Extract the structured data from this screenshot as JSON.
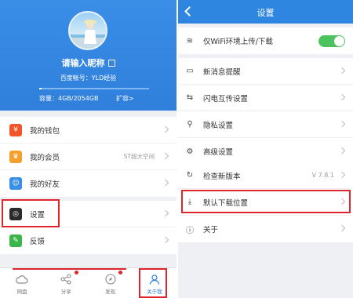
{
  "left": {
    "profile": {
      "nickname": "请输入昵称",
      "account": "百度帐号：YLD经验",
      "storage_text": "容量：4GB/2054GB",
      "storage_fraction": 0.0019,
      "expand_label": "扩容>"
    },
    "menu_group1": [
      {
        "label": "我的钱包",
        "icon": "wallet-icon",
        "color": "#f2552c",
        "glyph": "¥"
      },
      {
        "label": "我的会员",
        "icon": "crown-icon",
        "color": "#f4a02a",
        "glyph": "♛",
        "extra": "ST超大空间"
      },
      {
        "label": "我的好友",
        "icon": "friend-icon",
        "color": "#3a8ee6",
        "glyph": "☺"
      }
    ],
    "menu_group2": [
      {
        "label": "设置",
        "icon": "settings-icon",
        "color": "#2b2b2b",
        "glyph": "◎"
      },
      {
        "label": "反馈",
        "icon": "feedback-icon",
        "color": "#3bb54a",
        "glyph": "✎"
      }
    ],
    "tabs": [
      {
        "label": "网盘",
        "icon": "cloud-icon"
      },
      {
        "label": "分享",
        "icon": "share-icon",
        "badge": true
      },
      {
        "label": "发现",
        "icon": "compass-icon",
        "badge": true
      },
      {
        "label": "关于我",
        "icon": "person-icon",
        "active": true
      }
    ]
  },
  "right": {
    "title": "设置",
    "group1": [
      {
        "label": "仅WiFi环境上传/下载",
        "icon": "wifi-icon",
        "glyph": "≋",
        "toggle": true
      }
    ],
    "group2": [
      {
        "label": "新消息提醒",
        "icon": "message-icon",
        "glyph": "▭"
      },
      {
        "label": "闪电互传设置",
        "icon": "transfer-icon",
        "glyph": "⇆"
      },
      {
        "label": "隐私设置",
        "icon": "privacy-icon",
        "glyph": "⚲"
      },
      {
        "label": "高级设置",
        "icon": "gear-icon",
        "glyph": "⚙"
      }
    ],
    "group3": [
      {
        "label": "检查新版本",
        "icon": "refresh-icon",
        "glyph": "↻",
        "version": "V 7.8.1"
      },
      {
        "label": "默认下载位置",
        "icon": "download-icon",
        "glyph": "⤓"
      },
      {
        "label": "关于",
        "icon": "info-icon",
        "glyph": "ⓘ"
      }
    ]
  }
}
